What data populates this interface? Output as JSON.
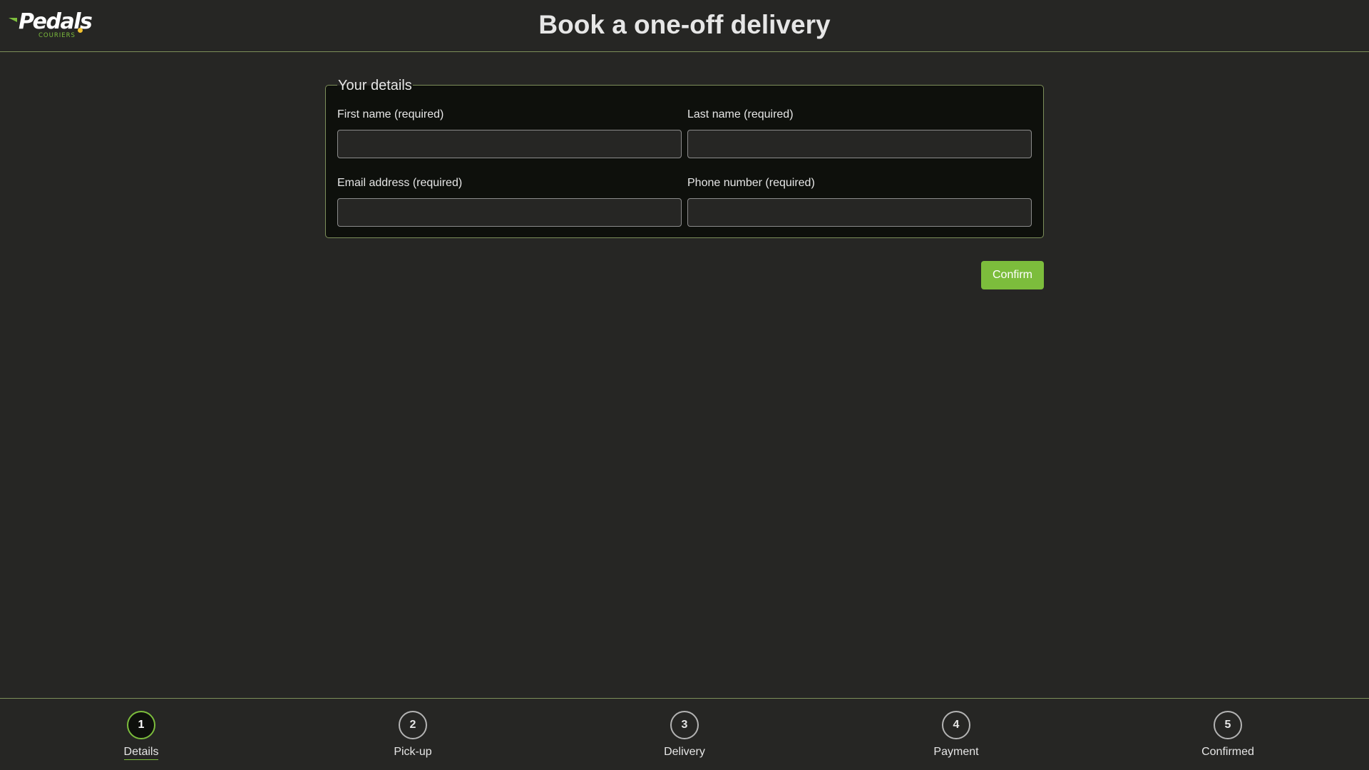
{
  "header": {
    "logo": {
      "name": "Pedals",
      "tagline": "COURIERS"
    },
    "title": "Book a one-off delivery"
  },
  "form": {
    "legend": "Your details",
    "fields": [
      {
        "label": "First name (required)",
        "value": "",
        "placeholder": ""
      },
      {
        "label": "Last name (required)",
        "value": "",
        "placeholder": ""
      },
      {
        "label": "Email address (required)",
        "value": "",
        "placeholder": ""
      },
      {
        "label": "Phone number (required)",
        "value": "",
        "placeholder": ""
      }
    ],
    "confirm_label": "Confirm"
  },
  "stepper": {
    "active_step": 1,
    "steps": [
      {
        "number": "1",
        "label": "Details"
      },
      {
        "number": "2",
        "label": "Pick-up"
      },
      {
        "number": "3",
        "label": "Delivery"
      },
      {
        "number": "4",
        "label": "Payment"
      },
      {
        "number": "5",
        "label": "Confirmed"
      }
    ]
  },
  "colors": {
    "accent": "#7cbd3c",
    "logo_dot": "#f2c230",
    "background": "#262624",
    "panel": "#0e100c"
  }
}
